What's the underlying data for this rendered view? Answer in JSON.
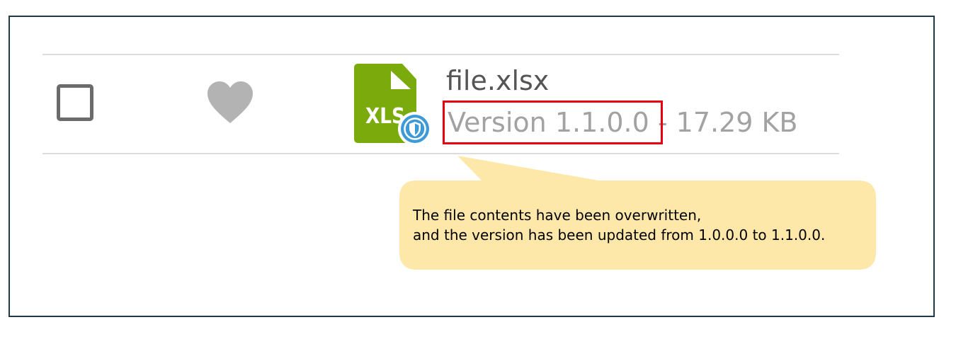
{
  "file_row": {
    "checkbox": {
      "checked": false
    },
    "favorite": {
      "active": false,
      "icon": "heart-icon",
      "color": "#b3b3b3"
    },
    "icon": {
      "label": "XLS",
      "name": "xls-file-icon",
      "color": "#7aaa0c",
      "badge": "shield-badge-icon",
      "badge_color": "#3d9ad6"
    },
    "name": "file.xlsx",
    "version": "Version 1.1.0.0",
    "separator": " - ",
    "size": "17.29 KB"
  },
  "callout": {
    "line1": "The file contents have been overwritten,",
    "line2": "and the version has been updated from 1.0.0.0 to 1.1.0.0.",
    "background": "#fde8a9"
  },
  "highlight_color": "#e60012"
}
